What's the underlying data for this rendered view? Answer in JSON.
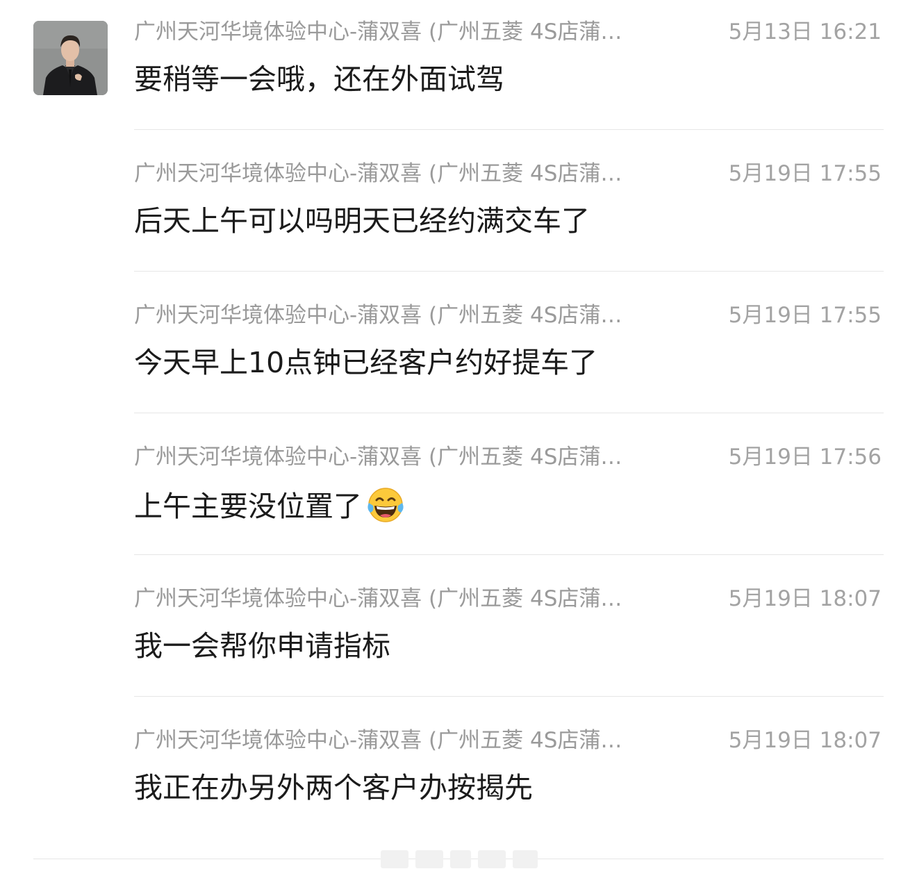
{
  "messages": [
    {
      "sender": "广州天河华境体验中心-蒲双喜 (广州五菱 4S店蒲…",
      "time": "5月13日 16:21",
      "text": "要稍等一会哦，还在外面试驾"
    },
    {
      "sender": "广州天河华境体验中心-蒲双喜 (广州五菱 4S店蒲…",
      "time": "5月19日 17:55",
      "text": "后天上午可以吗明天已经约满交车了"
    },
    {
      "sender": "广州天河华境体验中心-蒲双喜 (广州五菱 4S店蒲…",
      "time": "5月19日 17:55",
      "text": "今天早上10点钟已经客户约好提车了"
    },
    {
      "sender": "广州天河华境体验中心-蒲双喜 (广州五菱 4S店蒲…",
      "time": "5月19日 17:56",
      "text": "上午主要没位置了",
      "emoji": "laughing-with-tears-emoji"
    },
    {
      "sender": "广州天河华境体验中心-蒲双喜 (广州五菱 4S店蒲…",
      "time": "5月19日 18:07",
      "text": "我一会帮你申请指标"
    },
    {
      "sender": "广州天河华境体验中心-蒲双喜 (广州五菱 4S店蒲…",
      "time": "5月19日 18:07",
      "text": "我正在办另外两个客户办按揭先"
    }
  ],
  "colors": {
    "sender": "#9a9a9a",
    "time": "#a3a3a3",
    "text": "#1b1b1b",
    "divider": "#e6e6e6"
  }
}
